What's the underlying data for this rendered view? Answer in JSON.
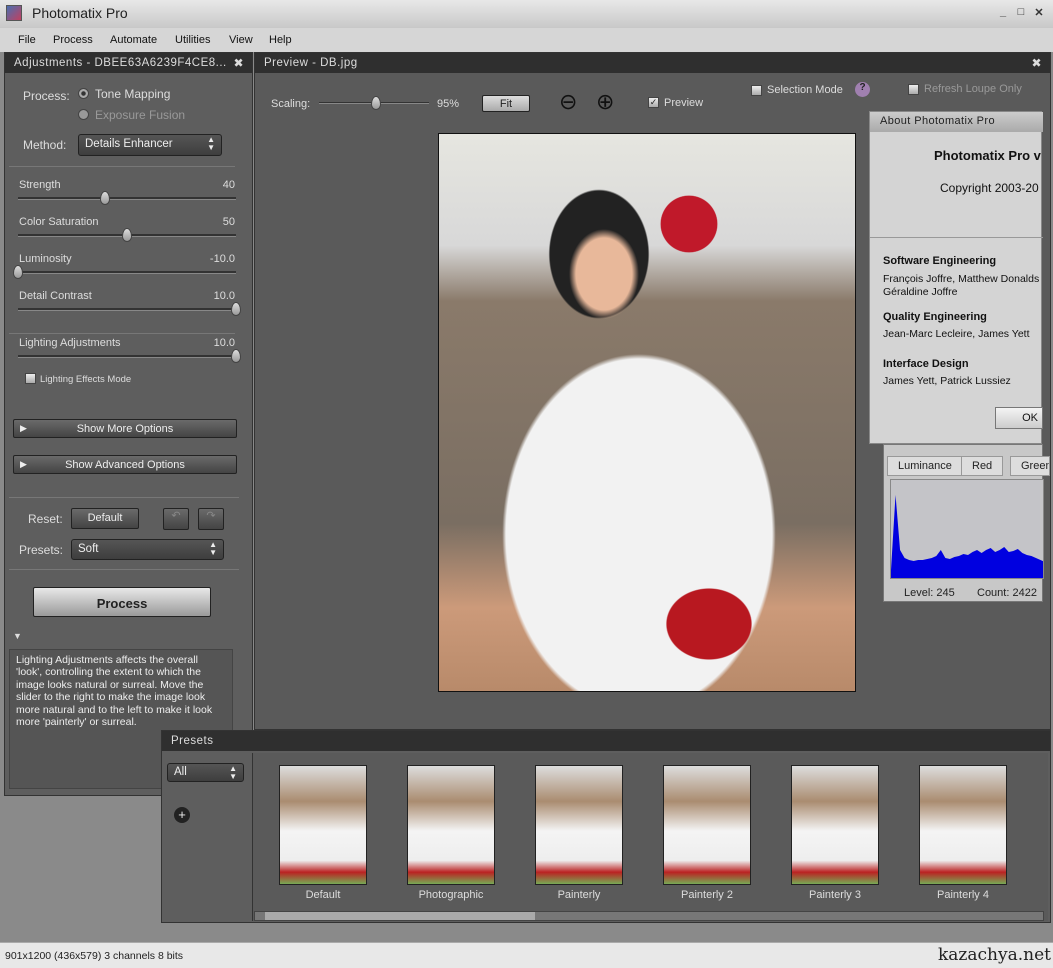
{
  "app": {
    "title": "Photomatix Pro"
  },
  "menu": [
    "File",
    "Process",
    "Automate",
    "Utilities",
    "View",
    "Help"
  ],
  "adjustments": {
    "header": "Adjustments - DBEE63A6239F4CE8...",
    "process_label": "Process:",
    "process_options": [
      {
        "label": "Tone Mapping",
        "selected": true
      },
      {
        "label": "Exposure Fusion",
        "selected": false
      }
    ],
    "method_label": "Method:",
    "method_value": "Details Enhancer",
    "sliders": [
      {
        "label": "Strength",
        "value": "40",
        "num": 40,
        "min": 0,
        "max": 100
      },
      {
        "label": "Color Saturation",
        "value": "50",
        "num": 50,
        "min": 0,
        "max": 100
      },
      {
        "label": "Luminosity",
        "value": "-10.0",
        "num": -10,
        "min": -10,
        "max": 10
      },
      {
        "label": "Detail Contrast",
        "value": "10.0",
        "num": 10,
        "min": -10,
        "max": 10
      },
      {
        "label": "Lighting Adjustments",
        "value": "10.0",
        "num": 10,
        "min": -10,
        "max": 10
      }
    ],
    "lighting_effects_mode": "Lighting Effects Mode",
    "show_more": "Show More Options",
    "show_advanced": "Show Advanced Options",
    "reset_label": "Reset:",
    "default_btn": "Default",
    "presets_label": "Presets:",
    "presets_value": "Soft",
    "process_btn": "Process",
    "help_text": "Lighting Adjustments affects the overall 'look', controlling the extent to which the image looks natural or surreal. Move the slider to the right to make the image look more natural and to the left to make it look more 'painterly' or surreal."
  },
  "preview": {
    "header": "Preview - DB.jpg",
    "scaling_label": "Scaling:",
    "scaling_value": "95%",
    "scaling_num": 95,
    "fit": "Fit",
    "preview_label": "Preview",
    "preview_checked": true,
    "selection_mode": "Selection Mode",
    "refresh_loupe": "Refresh Loupe Only"
  },
  "about": {
    "title": "About Photomatix Pro",
    "product": "Photomatix Pro v",
    "copyright": "Copyright 2003-20",
    "sections": [
      {
        "heading": "Software Engineering",
        "names": "François Joffre, Matthew Donalds",
        "names2": "Géraldine Joffre"
      },
      {
        "heading": "Quality Engineering",
        "names": "Jean-Marc Lecleire, James Yett"
      },
      {
        "heading": "Interface Design",
        "names": "James Yett, Patrick Lussiez"
      }
    ],
    "ok": "OK"
  },
  "histogram": {
    "tabs": [
      "Luminance",
      "Red",
      "Green"
    ],
    "level": "Level: 245",
    "count": "Count: 2422",
    "color": "#0000e0",
    "shape": [
      0.1,
      0.85,
      0.3,
      0.22,
      0.2,
      0.19,
      0.2,
      0.2,
      0.21,
      0.22,
      0.24,
      0.3,
      0.22,
      0.21,
      0.23,
      0.24,
      0.26,
      0.25,
      0.28,
      0.3,
      0.27,
      0.3,
      0.32,
      0.28,
      0.3,
      0.33,
      0.28,
      0.29,
      0.31,
      0.27,
      0.25,
      0.24,
      0.22,
      0.2,
      0.18
    ]
  },
  "presets": {
    "header": "Presets",
    "filter": "All",
    "items": [
      {
        "label": "Default"
      },
      {
        "label": "Photographic"
      },
      {
        "label": "Painterly"
      },
      {
        "label": "Painterly 2"
      },
      {
        "label": "Painterly 3"
      },
      {
        "label": "Painterly 4"
      }
    ]
  },
  "status": {
    "text": "901x1200 (436x579) 3 channels 8 bits",
    "watermark": "kazachya.net"
  }
}
